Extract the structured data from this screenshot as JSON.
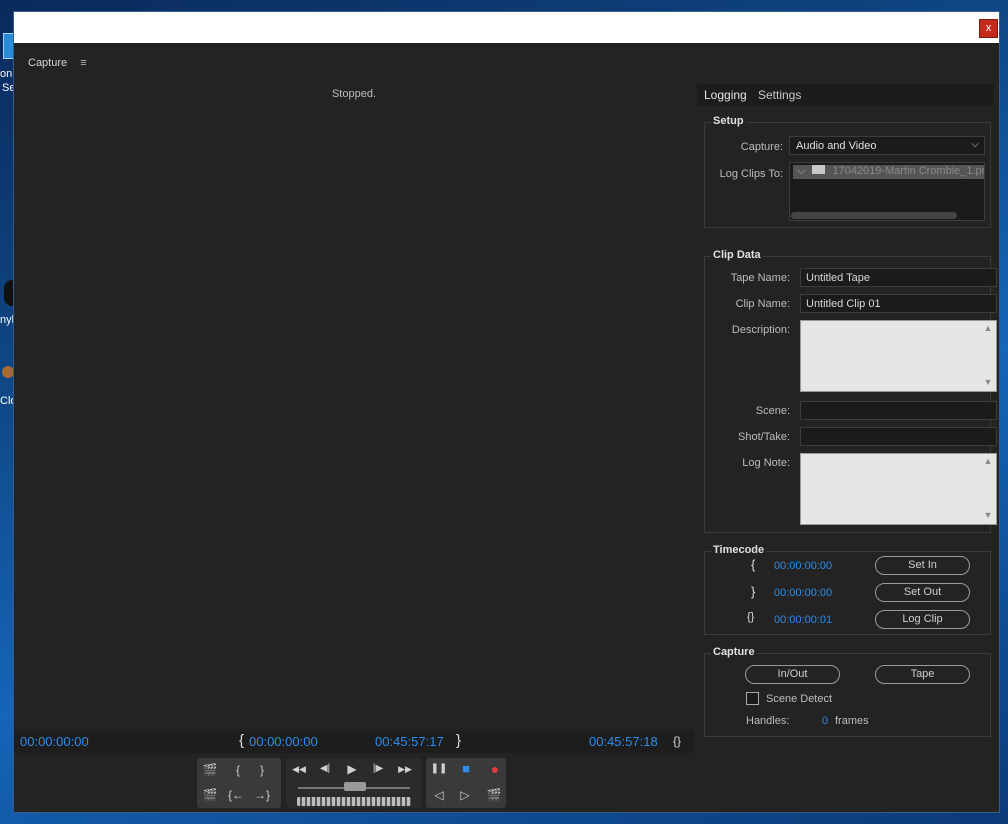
{
  "desktop": {
    "fragment_1": "on",
    "fragment_2": "Se",
    "fragment_3": "nyl",
    "fragment_4": "Clo"
  },
  "window": {
    "close_glyph": "x"
  },
  "panel": {
    "title": "Capture",
    "menu_glyph": "≡"
  },
  "preview": {
    "status": "Stopped."
  },
  "timecodes": {
    "current": "00:00:00:00",
    "in_point": "00:00:00:00",
    "out_point": "00:45:57:17",
    "duration": "00:45:57:18",
    "in_bracket": "{",
    "out_bracket": "}",
    "duration_bracket": "{}"
  },
  "controls": {
    "set_in": "{",
    "set_out": "}",
    "goto_in": "{←",
    "goto_out": "→}",
    "rewind": "◀◀",
    "step_back": "◀|",
    "play": "▶",
    "step_fwd": "|▶",
    "fast_fwd": "▶▶",
    "pause": "❚❚",
    "stop": "■",
    "record": "●",
    "slow_reverse": "◁",
    "slow_play": "▷"
  },
  "tabs": [
    {
      "label": "Logging",
      "active": true
    },
    {
      "label": "Settings",
      "active": false
    }
  ],
  "setup": {
    "title": "Setup",
    "capture_label": "Capture:",
    "capture_value": "Audio and Video",
    "log_clips_to_label": "Log Clips To:",
    "log_clips_to_item": "17042019-Martin Crombie_1.pr"
  },
  "clip_data": {
    "title": "Clip Data",
    "tape_name_label": "Tape Name:",
    "tape_name_value": "Untitled Tape",
    "clip_name_label": "Clip Name:",
    "clip_name_value": "Untitled Clip 01",
    "description_label": "Description:",
    "scene_label": "Scene:",
    "scene_value": "",
    "shot_take_label": "Shot/Take:",
    "shot_take_value": "",
    "log_note_label": "Log Note:"
  },
  "timecode_group": {
    "title": "Timecode",
    "in_value": "00:00:00:00",
    "out_value": "00:00:00:00",
    "duration_value": "00:00:00:01",
    "set_in_label": "Set In",
    "set_out_label": "Set Out",
    "log_clip_label": "Log Clip",
    "in_sym": "{",
    "out_sym": "}",
    "dur_sym": "{}"
  },
  "capture_group": {
    "title": "Capture",
    "in_out_label": "In/Out",
    "tape_label": "Tape",
    "scene_detect_label": "Scene Detect",
    "scene_detect_checked": false,
    "handles_label": "Handles:",
    "handles_value": "0",
    "handles_unit": "frames"
  },
  "colors": {
    "accent": "#2d8ceb",
    "panel_bg": "#232323",
    "record": "#e33b3b"
  }
}
